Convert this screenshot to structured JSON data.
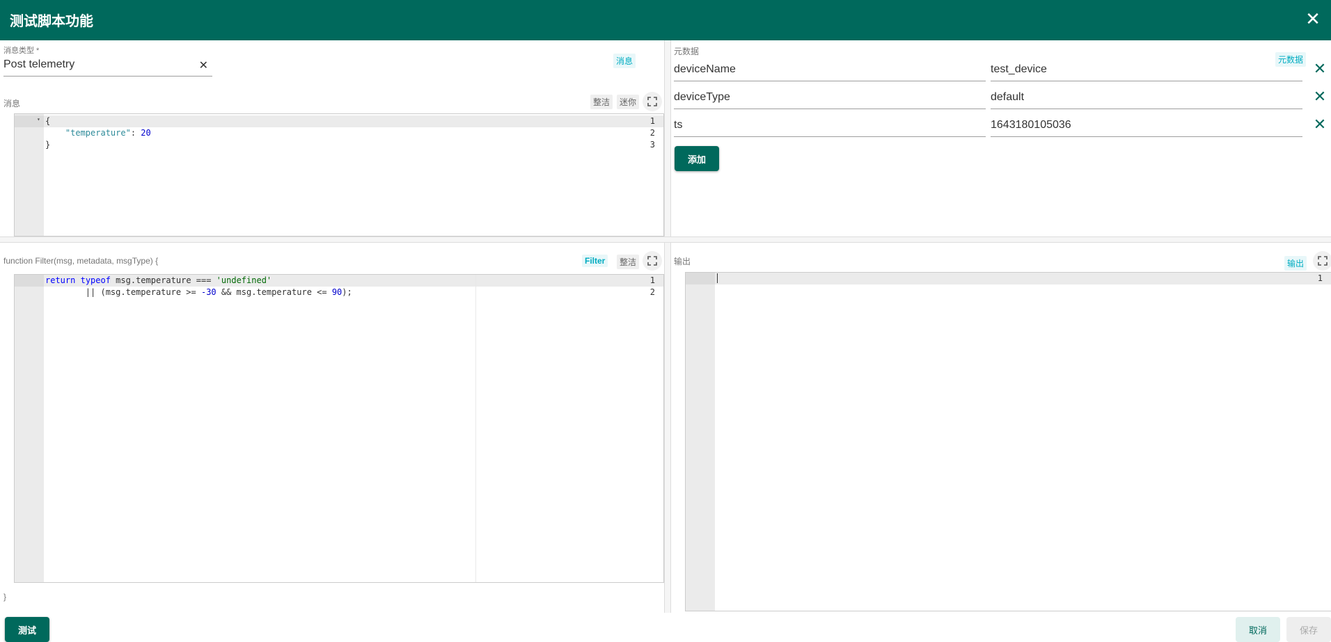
{
  "dialog": {
    "title": "测试脚本功能"
  },
  "message_type": {
    "label": "消息类型 *",
    "value": "Post telemetry"
  },
  "message_tag": "消息",
  "message_section": {
    "label": "消息",
    "tidy_label": "整洁",
    "mini_label": "迷你",
    "lines": [
      {
        "num": "1",
        "text": "{"
      },
      {
        "num": "2",
        "key": "\"temperature\"",
        "value": "20"
      },
      {
        "num": "3",
        "text": "}"
      }
    ]
  },
  "metadata": {
    "label": "元数据",
    "tag": "元数据",
    "rows": [
      {
        "key": "deviceName",
        "value": "test_device"
      },
      {
        "key": "deviceType",
        "value": "default"
      },
      {
        "key": "ts",
        "value": "1643180105036"
      }
    ],
    "add_label": "添加"
  },
  "function": {
    "signature": "function Filter(msg, metadata, msgType) {",
    "tag": "Filter",
    "tidy_label": "整洁",
    "closing": "}",
    "lines": [
      {
        "num": "1"
      },
      {
        "num": "2"
      }
    ]
  },
  "output": {
    "label": "输出",
    "tag": "输出",
    "line_num": "1"
  },
  "footer": {
    "test_label": "测试",
    "cancel_label": "取消",
    "save_label": "保存"
  }
}
